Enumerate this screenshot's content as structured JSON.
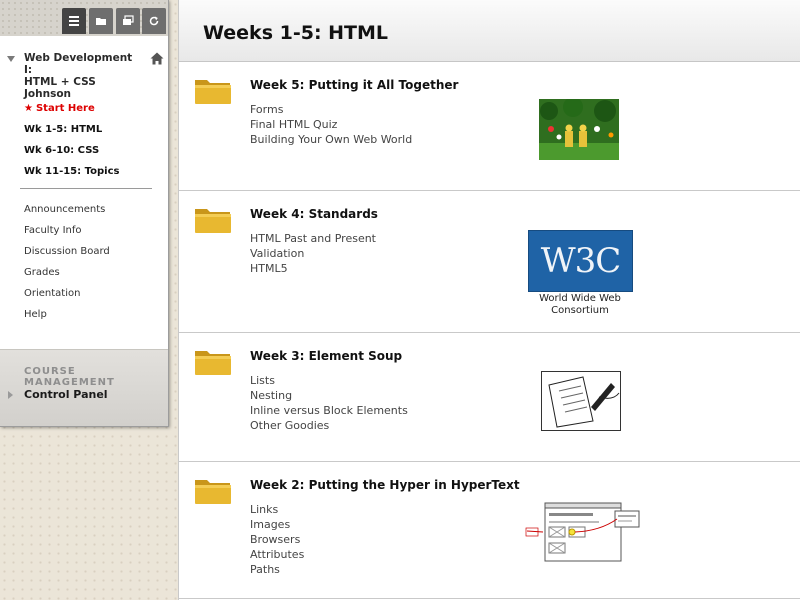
{
  "menu": {
    "toolbar_icons": [
      "list-icon",
      "folder-icon",
      "windows-icon",
      "refresh-icon"
    ],
    "course": {
      "line1": "Web Development I:",
      "line2": "HTML + CSS",
      "line3": "Johnson"
    },
    "main_items": [
      {
        "label": "Start Here",
        "icon": "star"
      },
      {
        "label": "Wk 1-5: HTML"
      },
      {
        "label": "Wk 6-10: CSS"
      },
      {
        "label": "Wk 11-15: Topics"
      }
    ],
    "tool_items": [
      {
        "label": "Announcements"
      },
      {
        "label": "Faculty Info"
      },
      {
        "label": "Discussion Board"
      },
      {
        "label": "Grades"
      },
      {
        "label": "Orientation"
      },
      {
        "label": "Help"
      }
    ],
    "management": {
      "title": "COURSE MANAGEMENT",
      "control_panel": "Control Panel"
    }
  },
  "page": {
    "title": "Weeks 1-5: HTML",
    "weeks": [
      {
        "title": "Week 5: Putting it All Together",
        "links": [
          "Forms",
          "Final HTML Quiz",
          "Building Your Own Web World"
        ]
      },
      {
        "title": "Week 4: Standards",
        "links": [
          "HTML Past and Present",
          "Validation",
          "HTML5"
        ],
        "image_text": "W3C",
        "caption_line1": "World Wide Web",
        "caption_line2": "Consortium"
      },
      {
        "title": "Week 3: Element Soup",
        "links": [
          "Lists",
          "Nesting",
          "Inline versus Block Elements",
          "Other Goodies"
        ]
      },
      {
        "title": "Week 2: Putting the Hyper in HyperText",
        "links": [
          "Links",
          "Images",
          "Browsers",
          "Attributes",
          "Paths"
        ]
      }
    ]
  },
  "colors": {
    "start_here": "#dd0000",
    "folder": "#e8b830",
    "w3c_bg": "#1f63a6"
  }
}
